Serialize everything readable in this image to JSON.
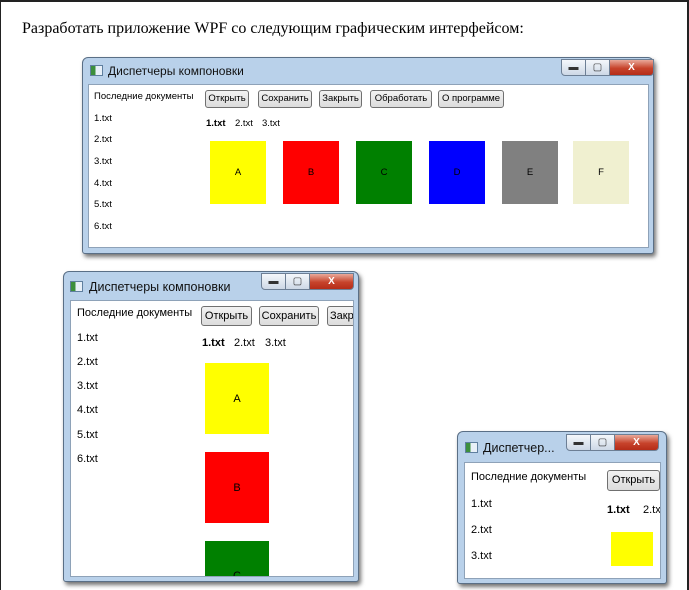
{
  "page_heading": "Разработать приложение WPF со следующим графическим интерфейсом:",
  "window_title": "Диспетчеры компоновки",
  "window_title_small": "Диспетчер...",
  "recent_heading": "Последние документы",
  "recent_items": [
    "1.txt",
    "2.txt",
    "3.txt",
    "4.txt",
    "5.txt",
    "6.txt"
  ],
  "buttons": {
    "open": "Открыть",
    "save": "Сохранить",
    "close": "Закрыть",
    "close_clipped": "Закр",
    "process": "Обработать",
    "about": "О программе"
  },
  "tabs": [
    "1.txt",
    "2.txt",
    "3.txt"
  ],
  "tabs_small_second": "2.txt",
  "tiles": [
    {
      "label": "A",
      "color": "#ffff00"
    },
    {
      "label": "B",
      "color": "#ff0000"
    },
    {
      "label": "C",
      "color": "#008000"
    },
    {
      "label": "D",
      "color": "#0000ff"
    },
    {
      "label": "E",
      "color": "#808080"
    },
    {
      "label": "F",
      "color": "#f0f0d0"
    }
  ],
  "caption_glyphs": {
    "minimize": "▬",
    "maximize": "▢",
    "close": "X"
  }
}
